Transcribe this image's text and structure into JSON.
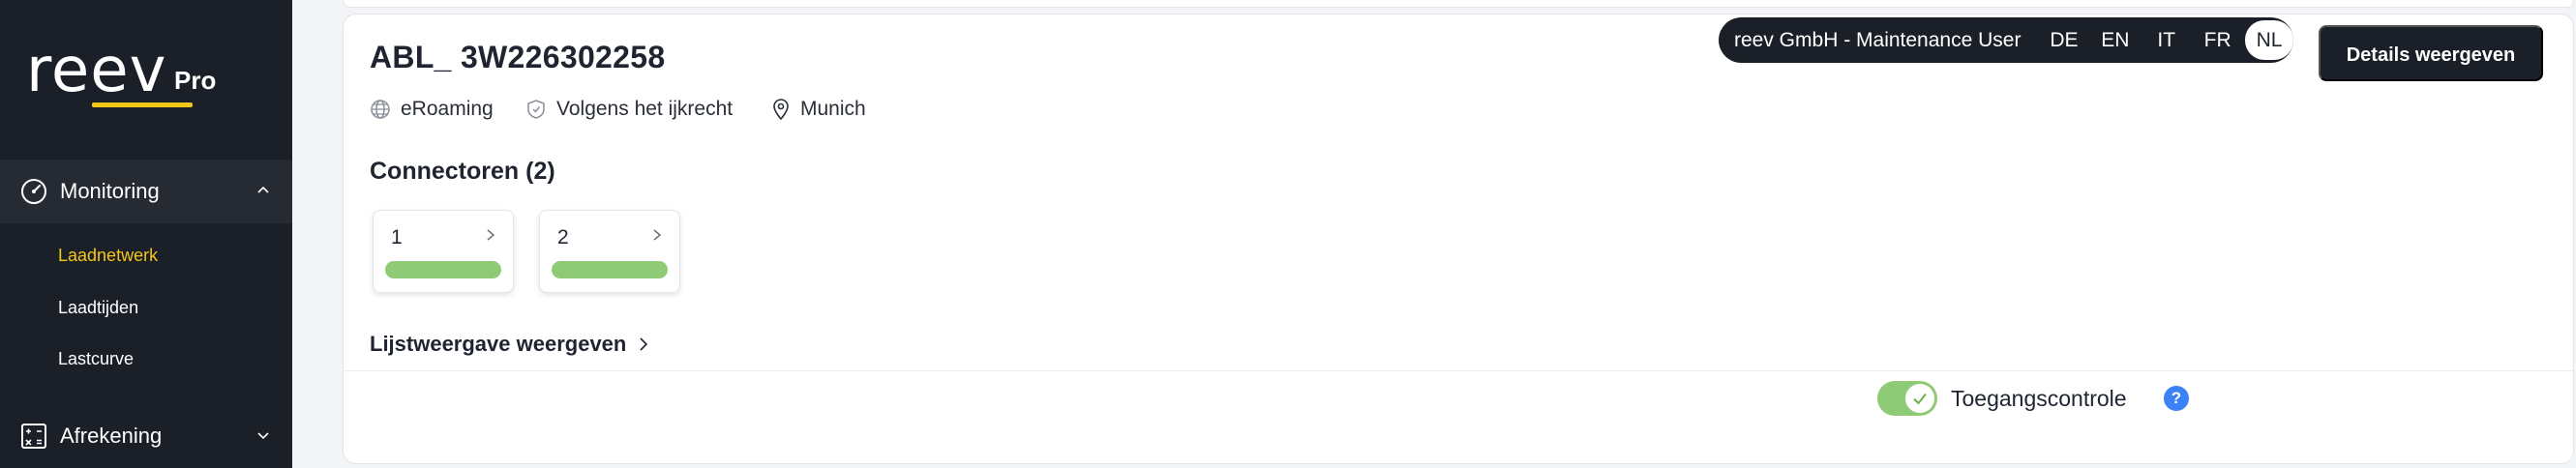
{
  "app": {
    "logo_word": "reev",
    "logo_suffix": "Pro",
    "brand_accent": "#f5c518"
  },
  "sidebar": {
    "groups": [
      {
        "label": "Monitoring",
        "icon": "gauge-icon",
        "expanded": true,
        "items": [
          {
            "label": "Laadnetwerk",
            "active": true
          },
          {
            "label": "Laadtijden",
            "active": false
          },
          {
            "label": "Lastcurve",
            "active": false
          }
        ]
      },
      {
        "label": "Afrekening",
        "icon": "calculator-icon",
        "expanded": false,
        "items": []
      }
    ]
  },
  "header": {
    "user_label": "reev GmbH - Maintenance User",
    "languages": [
      "DE",
      "EN",
      "IT",
      "FR",
      "NL"
    ],
    "selected_language": "NL",
    "details_button": "Details weergeven"
  },
  "station": {
    "title": "ABL_ 3W226302258",
    "meta": [
      {
        "icon": "globe-icon",
        "text": "eRoaming"
      },
      {
        "icon": "shield-icon",
        "text": "Volgens het ijkrecht"
      },
      {
        "icon": "location-pin-icon",
        "text": "Munich"
      }
    ],
    "connectors_title": "Connectoren (2)",
    "connectors": [
      {
        "number": "1",
        "status_color": "#8fcb76"
      },
      {
        "number": "2",
        "status_color": "#8fcb76"
      }
    ],
    "list_view_link": "Lijstweergave weergeven"
  },
  "footer": {
    "access_control_label": "Toegangscontrole",
    "access_control_enabled": true,
    "help_symbol": "?"
  }
}
